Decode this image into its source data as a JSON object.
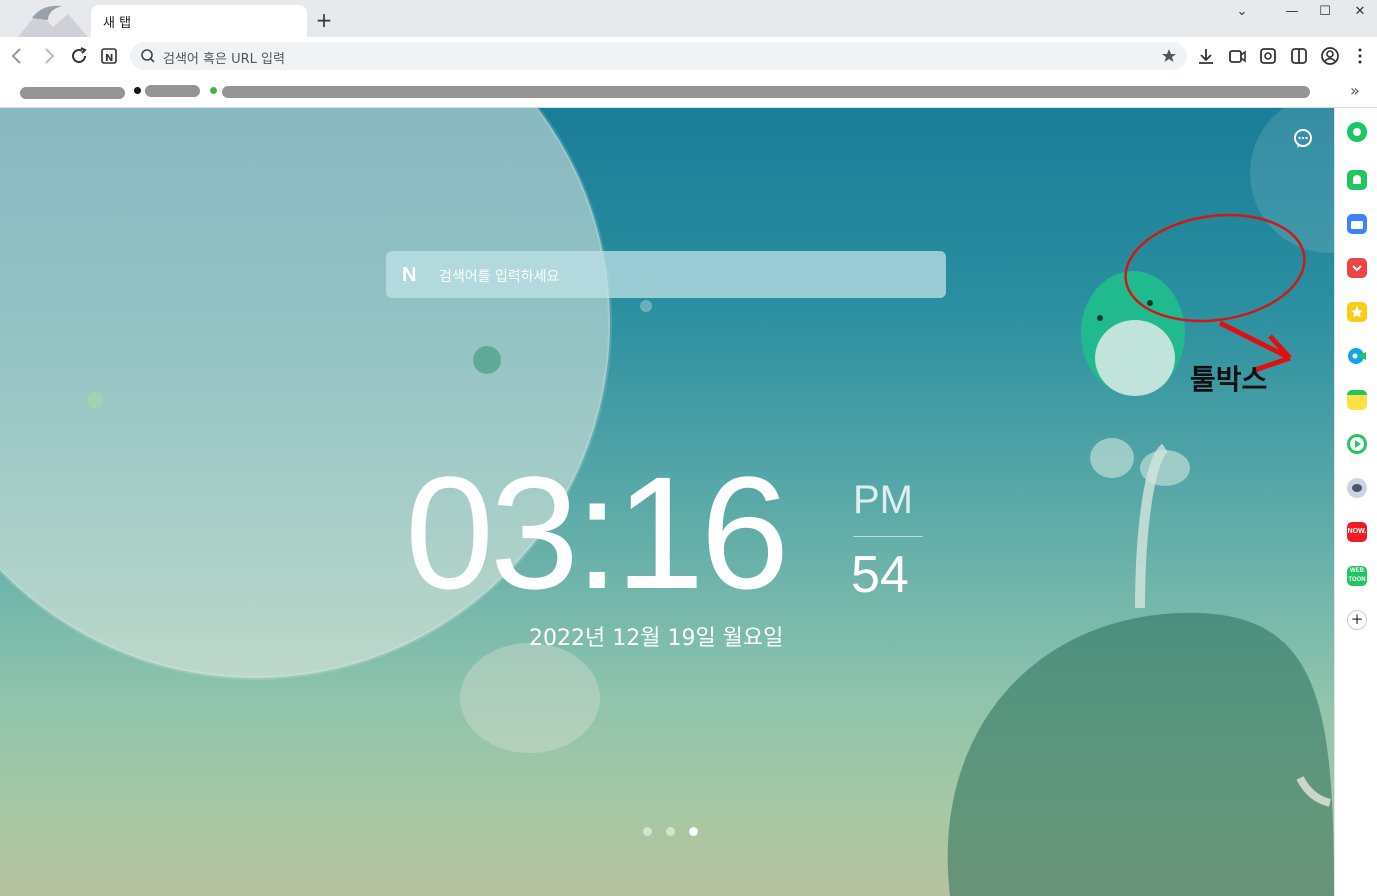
{
  "tab": {
    "title": "새 탭"
  },
  "omnibox": {
    "placeholder": "검색어 혹은 URL 입력"
  },
  "search": {
    "placeholder": "검색어를 입력하세요",
    "logo": "N"
  },
  "clock": {
    "time": "03:16",
    "ampm": "PM",
    "seconds": "54",
    "date": "2022년 12월 19일 월요일"
  },
  "annotation": {
    "label": "툴박스"
  },
  "pager": {
    "count": 3,
    "active": 3
  },
  "sidebar": {
    "items": [
      {
        "icon": "green-circle-icon",
        "color": "#17c964"
      },
      {
        "icon": "bell-icon",
        "color": "#22c55e"
      },
      {
        "icon": "briefcase-icon",
        "color": "#3b82f6"
      },
      {
        "icon": "pocket-icon",
        "color": "#ef4444"
      },
      {
        "icon": "star-icon",
        "color": "#facc15"
      },
      {
        "icon": "translate-icon",
        "color": "#0ea5e9"
      },
      {
        "icon": "memo-icon",
        "color": "#facc15"
      },
      {
        "icon": "play-icon",
        "color": "#22c55e"
      },
      {
        "icon": "character-icon",
        "color": "#64748b"
      },
      {
        "icon": "now-icon",
        "color": "#ef1c24"
      },
      {
        "icon": "webtoon-icon",
        "color": "#22c55e"
      },
      {
        "icon": "plus-icon",
        "color": "#333333"
      }
    ]
  }
}
